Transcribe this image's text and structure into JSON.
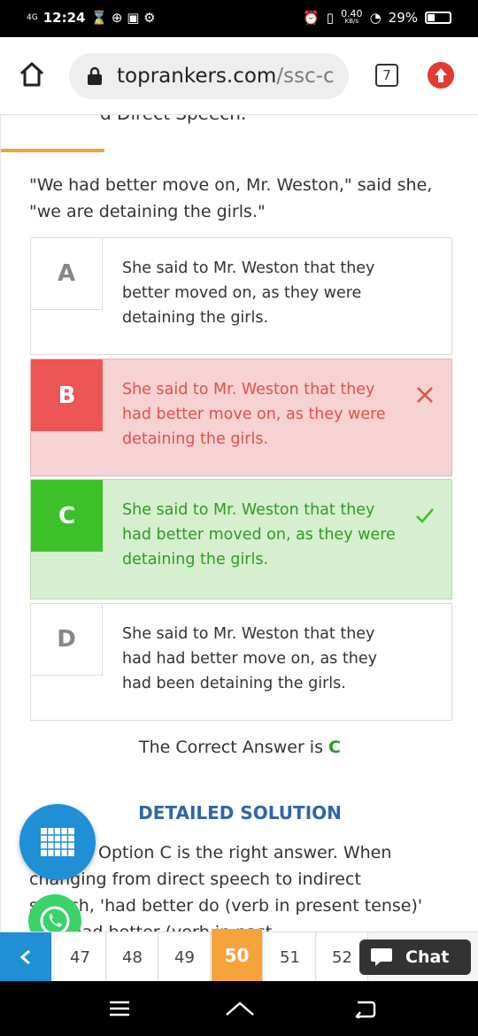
{
  "status_bar": {
    "network": "4G",
    "time": "12:24",
    "speed_value": "0.40",
    "speed_unit": "KB/s",
    "battery": "29%"
  },
  "browser": {
    "url_host": "toprankers.com",
    "url_path": "/ssc-c",
    "tab_count": "7"
  },
  "question": {
    "cut_text": "d Direct Speech.",
    "text": "\"We had better move on, Mr. Weston,\" said she, \"we are detaining the girls.\""
  },
  "options": [
    {
      "letter": "A",
      "text": "She said to Mr. Weston that they better moved on, as they were detaining the girls."
    },
    {
      "letter": "B",
      "text": "She said to Mr. Weston that they had better move on, as they were detaining the girls."
    },
    {
      "letter": "C",
      "text": "She said to Mr. Weston that they had better moved on, as they were detaining the girls."
    },
    {
      "letter": "D",
      "text": "She said to Mr. Weston that they had had better move on, as they had been detaining the girls."
    }
  ],
  "result": {
    "prefix": "The Correct Answer is ",
    "answer": "C"
  },
  "solution": {
    "title": "DETAILED SOLUTION",
    "line1": "Option C is the right answer. When",
    "line2": "changing from direct speech to indirect",
    "line3": "speech, 'had better do (verb in present tense)'",
    "line4": "into 'had better (verb in past"
  },
  "question_nav": {
    "numbers": [
      "47",
      "48",
      "49",
      "50",
      "51",
      "52"
    ],
    "active": "50",
    "chat_label": "Chat"
  },
  "colors": {
    "accent_blue": "#1f8fd6",
    "wrong_red": "#ee5555",
    "correct_green": "#3cc12a",
    "active_orange": "#f6a33b"
  }
}
